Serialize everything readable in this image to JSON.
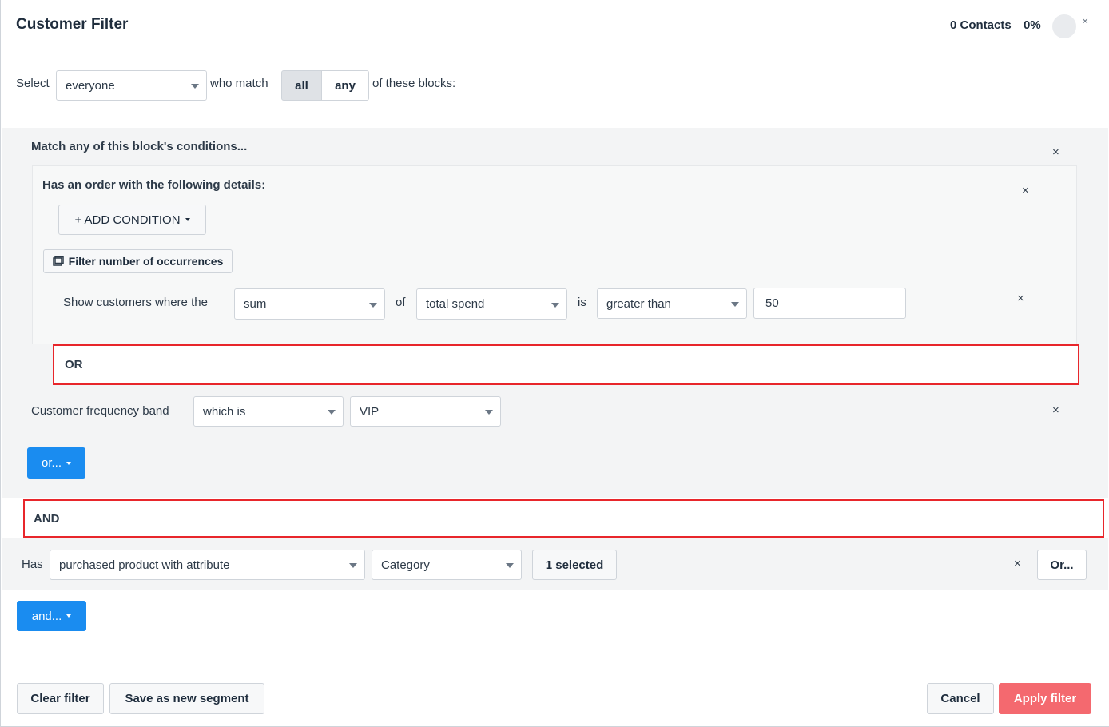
{
  "header": {
    "title": "Customer Filter",
    "contacts": "0 Contacts",
    "percent": "0%"
  },
  "select_row": {
    "select_label": "Select",
    "audience_value": "everyone",
    "who_match": "who match",
    "match_all": "all",
    "match_any": "any",
    "of_these_blocks": "of these blocks:"
  },
  "block1": {
    "title": "Match any of this block's conditions...",
    "order_card": {
      "title": "Has an order with the following details:",
      "add_condition": "+ ADD CONDITION",
      "filter_occurrences": "Filter number of occurrences",
      "show_customers": "Show customers where the",
      "aggregate_value": "sum",
      "of": "of",
      "field_value": "total spend",
      "is": "is",
      "operator_value": "greater than",
      "amount_value": "50"
    },
    "or_separator": "OR",
    "frequency": {
      "label": "Customer frequency band",
      "operator_value": "which is",
      "band_value": "VIP"
    },
    "or_button": "or..."
  },
  "and_separator": "AND",
  "block2": {
    "has_label": "Has",
    "condition_value": "purchased product with attribute",
    "attribute_value": "Category",
    "selected_label": "1 selected",
    "or_button": "Or..."
  },
  "and_button": "and...",
  "footer": {
    "clear": "Clear filter",
    "save_segment": "Save as new segment",
    "cancel": "Cancel",
    "apply": "Apply filter"
  },
  "icons": {
    "close": "×"
  },
  "colors": {
    "primary_blue": "#1a8cf0",
    "apply_red": "#f4696f",
    "highlight_red": "#e8262b"
  }
}
